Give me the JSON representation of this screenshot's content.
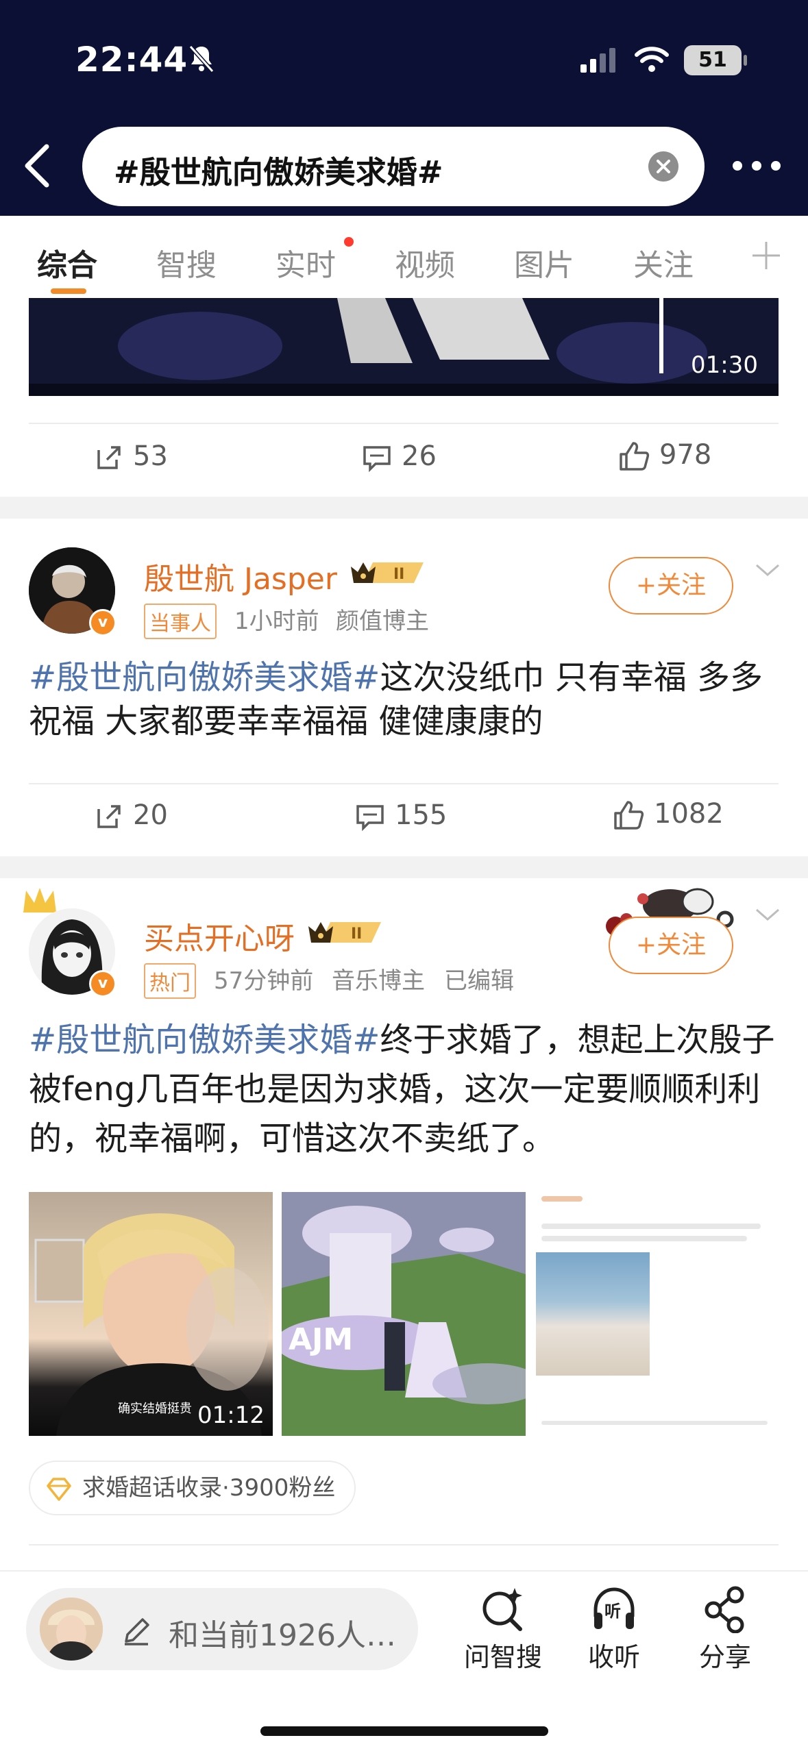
{
  "status_bar": {
    "time": "22:44",
    "battery": "51"
  },
  "search": {
    "query": "#殷世航向傲娇美求婚#"
  },
  "tabs": [
    {
      "label": "综合",
      "active": true
    },
    {
      "label": "智搜",
      "active": false
    },
    {
      "label": "实时",
      "active": false,
      "badge_dot": true
    },
    {
      "label": "视频",
      "active": false
    },
    {
      "label": "图片",
      "active": false
    },
    {
      "label": "关注",
      "active": false
    }
  ],
  "card1": {
    "video_duration": "01:30",
    "reposts": "53",
    "comments": "26",
    "likes": "978"
  },
  "card2": {
    "username": "殷世航 Jasper",
    "tag": "当事人",
    "time": "1小时前",
    "role": "颜值博主",
    "follow_label": "+关注",
    "topic": "#殷世航向傲娇美求婚#",
    "text": "这次没纸巾 只有幸福 多多祝福 大家都要幸幸福福 健健康康的",
    "reposts": "20",
    "comments": "155",
    "likes": "1082"
  },
  "card3": {
    "username": "买点开心呀",
    "tag": "热门",
    "time": "57分钟前",
    "role": "音乐博主",
    "edited": "已编辑",
    "follow_label": "+关注",
    "topic": "#殷世航向傲娇美求婚#",
    "text": "终于求婚了，想起上次殷子被feng几百年也是因为求婚，这次一定要顺顺利利的，祝幸福啊，可惜这次不卖纸了。",
    "image1_duration": "01:12",
    "image1_caption": "确实结婚挺贵",
    "image2_overlay": "AJM",
    "super_topic": "求婚超话收录·3900粉丝"
  },
  "bottom_bar": {
    "comment_placeholder": "和当前1926人…",
    "ask_label": "问智搜",
    "listen_label": "收听",
    "share_label": "分享"
  },
  "colors": {
    "accent": "#f08a3a",
    "topic": "#4f74ad",
    "header_bg": "#0c1035"
  }
}
